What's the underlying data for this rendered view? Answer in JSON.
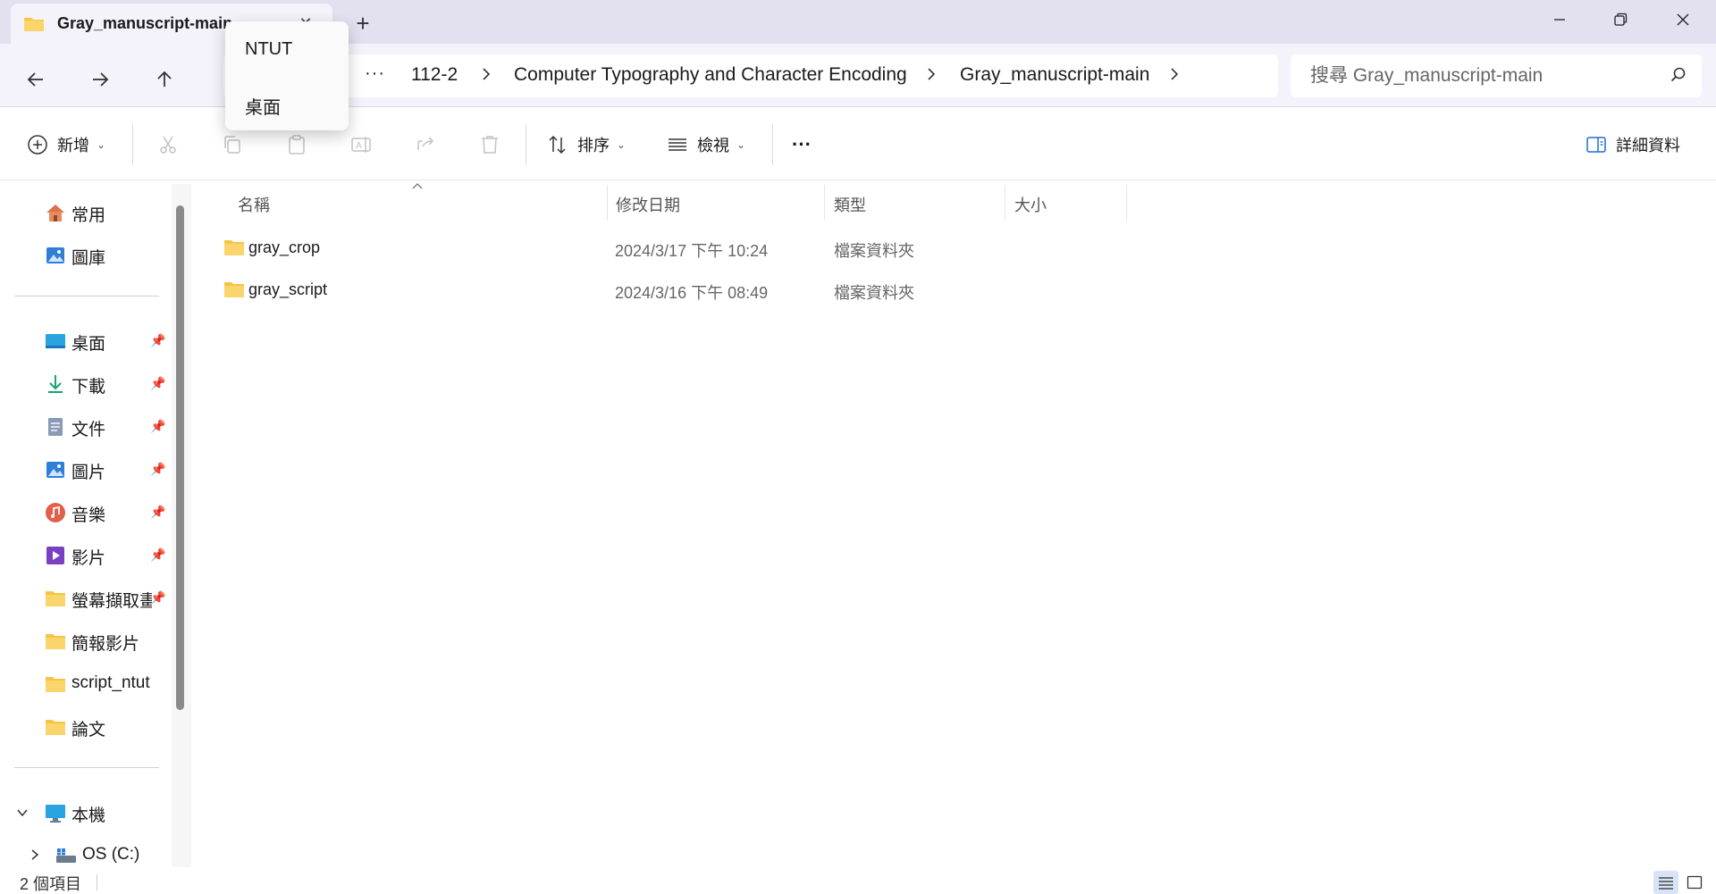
{
  "window": {
    "tab_title": "Gray_manuscript-main",
    "close_tab_glyph": "✕",
    "new_tab_glyph": "+"
  },
  "address": {
    "more_glyph": "···",
    "crumbs": [
      "112-2",
      "Computer Typography and Character Encoding",
      "Gray_manuscript-main"
    ]
  },
  "search": {
    "placeholder": "搜尋 Gray_manuscript-main"
  },
  "flyout": {
    "items": [
      "NTUT",
      "桌面"
    ]
  },
  "toolbar": {
    "new_label": "新增",
    "sort_label": "排序",
    "view_label": "檢視",
    "more_glyph": "···",
    "details_label": "詳細資料"
  },
  "sidebar": {
    "top": [
      {
        "label": "常用",
        "icon": "home-icon"
      },
      {
        "label": "圖庫",
        "icon": "gallery-icon"
      }
    ],
    "pinned": [
      {
        "label": "桌面",
        "icon": "desktop-icon"
      },
      {
        "label": "下載",
        "icon": "download-icon"
      },
      {
        "label": "文件",
        "icon": "document-icon"
      },
      {
        "label": "圖片",
        "icon": "pictures-icon"
      },
      {
        "label": "音樂",
        "icon": "music-icon"
      },
      {
        "label": "影片",
        "icon": "video-icon"
      },
      {
        "label": "螢幕擷取畫面",
        "icon": "folder-icon"
      },
      {
        "label": "簡報影片",
        "icon": "folder-icon"
      },
      {
        "label": "script_ntut",
        "icon": "folder-icon"
      },
      {
        "label": "論文",
        "icon": "folder-icon"
      }
    ],
    "this_pc": {
      "label": "本機",
      "icon": "computer-icon"
    },
    "drive": {
      "label": "OS (C:)",
      "icon": "drive-icon"
    }
  },
  "columns": {
    "name": "名稱",
    "modified": "修改日期",
    "type": "類型",
    "size": "大小"
  },
  "files": [
    {
      "name": "gray_crop",
      "modified": "2024/3/17 下午 10:24",
      "type": "檔案資料夾"
    },
    {
      "name": "gray_script",
      "modified": "2024/3/16 下午 08:49",
      "type": "檔案資料夾"
    }
  ],
  "status": {
    "count": "2 個項目"
  },
  "colors": {
    "tabstrip_bg": "#e3e0f0",
    "navbar_bg": "#f4f3fb",
    "folder_yellow": "#f5c542",
    "accent_blue": "#1f6fd1"
  }
}
